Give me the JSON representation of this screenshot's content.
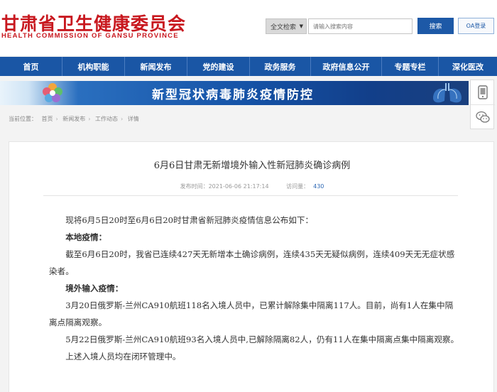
{
  "header": {
    "logo_cn": "甘肃省卫生健康委员会",
    "logo_en": "HEALTH COMMISSION OF GANSU PROVINCE",
    "search_scope": "全文检索",
    "search_placeholder": "请输入搜索内容",
    "search_button": "搜索",
    "oa_button": "OA登录"
  },
  "nav": {
    "items": [
      {
        "label": "首页"
      },
      {
        "label": "机构职能"
      },
      {
        "label": "新闻发布"
      },
      {
        "label": "党的建设"
      },
      {
        "label": "政务服务"
      },
      {
        "label": "政府信息公开"
      },
      {
        "label": "专题专栏"
      },
      {
        "label": "深化医改"
      }
    ]
  },
  "banner": {
    "text": "新型冠状病毒肺炎疫情防控"
  },
  "breadcrumb": {
    "prefix": "当前位置：",
    "items": [
      "首页",
      "新闻发布",
      "工作动态",
      "详情"
    ]
  },
  "article": {
    "title": "6月6日甘肃无新增境外输入性新冠肺炎确诊病例",
    "published_label": "发布时间：",
    "published_value": "2021-06-06 21:17:14",
    "views_label": "访问量：",
    "views_value": "430",
    "paragraphs": [
      "现将6月5日20时至6月6日20时甘肃省新冠肺炎疫情信息公布如下：",
      "本地疫情：",
      "截至6月6日20时，我省已连续427天无新增本土确诊病例，连续435天无疑似病例，连续409天无无症状感染者。",
      "境外输入疫情：",
      "3月20日俄罗斯-兰州CA910航班118名入境人员中，已累计解除集中隔离117人。目前，尚有1人在集中隔离点隔离观察。",
      "5月22日俄罗斯-兰州CA910航班93名入境人员中,已解除隔离82人，仍有11人在集中隔离点集中隔离观察。",
      "上述入境人员均在闭环管理中。"
    ]
  },
  "colors": {
    "brand_red": "#c8181f",
    "nav_blue": "#1a56a5",
    "button_blue": "#1d59a7"
  }
}
